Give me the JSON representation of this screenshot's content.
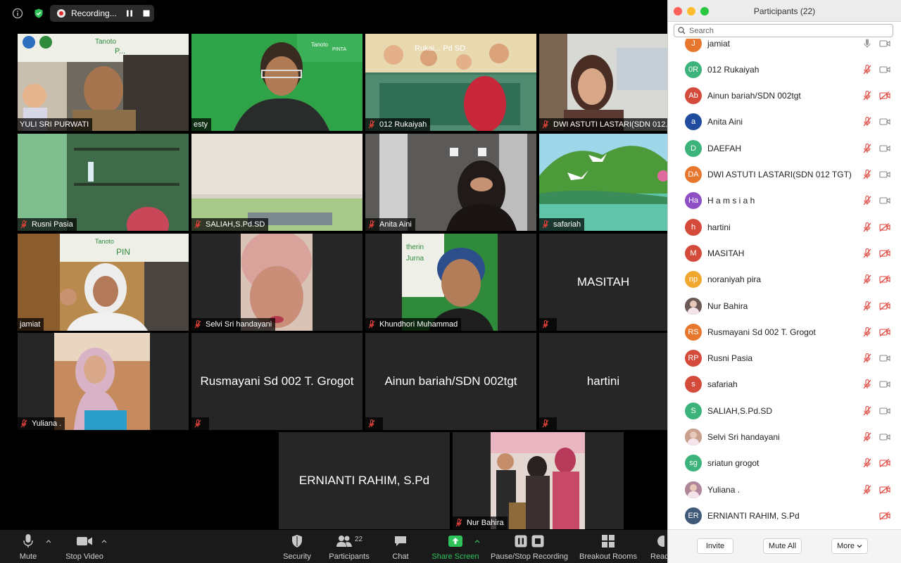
{
  "recording": {
    "label": "Recording..."
  },
  "tiles": [
    {
      "name": "YULI SRI PURWATI",
      "muted": false,
      "active": true,
      "scene": "classroom-poster"
    },
    {
      "name": "esty",
      "muted": false,
      "scene": "green-wall"
    },
    {
      "name": "012 Rukaiyah",
      "muted": true,
      "scene": "kids-banner"
    },
    {
      "name": "DWI ASTUTI LASTARI(SDN 012...",
      "muted": true,
      "scene": "office"
    },
    {
      "name": "Rusni Pasia",
      "muted": true,
      "scene": "shelf"
    },
    {
      "name": "SALIAH,S.Pd.SD",
      "muted": true,
      "scene": "ceiling"
    },
    {
      "name": "Anita Aini",
      "muted": true,
      "scene": "dark-room"
    },
    {
      "name": "safariah",
      "muted": true,
      "scene": "landscape"
    },
    {
      "name": "jamiat",
      "muted": false,
      "scene": "room-poster"
    },
    {
      "name": "Selvi Sri handayani",
      "muted": true,
      "scene": "closeup"
    },
    {
      "name": "Khundhori Muhammad",
      "muted": true,
      "scene": "portrait-green"
    },
    {
      "name": "",
      "muted": true,
      "bigname": "MASITAH"
    },
    {
      "name": "Yuliana .",
      "muted": true,
      "scene": "portrait-hijab"
    },
    {
      "name": "",
      "muted": true,
      "bigname": "Rusmayani Sd 002 T. Grogot"
    },
    {
      "name": "",
      "muted": true,
      "bigname": "Ainun bariah/SDN 002tgt"
    },
    {
      "name": "",
      "muted": true,
      "bigname": "hartini"
    },
    {
      "name": "",
      "muted": false,
      "bigname": "ERNIANTI RAHIM, S.Pd"
    },
    {
      "name": "Nur Bahira",
      "muted": true,
      "scene": "family"
    }
  ],
  "toolbar": {
    "mute": "Mute",
    "stop_video": "Stop Video",
    "security": "Security",
    "participants": "Participants",
    "participants_count": "22",
    "chat": "Chat",
    "share_screen": "Share Screen",
    "pause_recording": "Pause/Stop Recording",
    "breakout": "Breakout Rooms",
    "reactions": "Reac"
  },
  "panel": {
    "title": "Participants (22)",
    "search_placeholder": "Search",
    "invite": "Invite",
    "mute_all": "Mute All",
    "more": "More"
  },
  "participants": [
    {
      "name": "jamiat",
      "initials": "J",
      "color": "#e8772e",
      "mic": "on",
      "cam": "on"
    },
    {
      "name": "012 Rukaiyah",
      "initials": "0R",
      "color": "#3cb37a",
      "mic": "muted",
      "cam": "on"
    },
    {
      "name": "Ainun bariah/SDN 002tgt",
      "initials": "Ab",
      "color": "#d44b3b",
      "mic": "muted",
      "cam": "off"
    },
    {
      "name": "Anita Aini",
      "initials": "a",
      "color": "#1f4c9e",
      "mic": "muted",
      "cam": "on"
    },
    {
      "name": "DAEFAH",
      "initials": "D",
      "color": "#3cb37a",
      "mic": "muted",
      "cam": "on"
    },
    {
      "name": "DWI ASTUTI LASTARI(SDN 012 TGT)",
      "initials": "DA",
      "color": "#e8772e",
      "mic": "muted",
      "cam": "on"
    },
    {
      "name": "H a m s i a h",
      "initials": "Ha",
      "color": "#8e4fc4",
      "mic": "muted",
      "cam": "on"
    },
    {
      "name": "hartini",
      "initials": "h",
      "color": "#d44b3b",
      "mic": "muted",
      "cam": "off"
    },
    {
      "name": "MASITAH",
      "initials": "M",
      "color": "#d44b3b",
      "mic": "muted",
      "cam": "off"
    },
    {
      "name": "noraniyah pira",
      "initials": "np",
      "color": "#f0a830",
      "mic": "muted",
      "cam": "off"
    },
    {
      "name": "Nur Bahira",
      "initials": "",
      "color": "#6b5a55",
      "photo": true,
      "mic": "muted",
      "cam": "off"
    },
    {
      "name": "Rusmayani Sd 002 T. Grogot",
      "initials": "RS",
      "color": "#e8772e",
      "mic": "muted",
      "cam": "off"
    },
    {
      "name": "Rusni Pasia",
      "initials": "RP",
      "color": "#d44b3b",
      "mic": "muted",
      "cam": "on"
    },
    {
      "name": "safariah",
      "initials": "s",
      "color": "#d44b3b",
      "mic": "muted",
      "cam": "on"
    },
    {
      "name": "SALIAH,S.Pd.SD",
      "initials": "S",
      "color": "#3cb37a",
      "mic": "muted",
      "cam": "on"
    },
    {
      "name": "Selvi Sri handayani",
      "initials": "",
      "color": "#c9a08e",
      "photo": true,
      "mic": "muted",
      "cam": "on"
    },
    {
      "name": "sriatun grogot",
      "initials": "sg",
      "color": "#3cb37a",
      "mic": "muted",
      "cam": "off"
    },
    {
      "name": "Yuliana .",
      "initials": "",
      "color": "#b0879a",
      "photo": true,
      "mic": "muted",
      "cam": "off"
    },
    {
      "name": "ERNIANTI RAHIM, S.Pd",
      "initials": "ER",
      "color": "#3f5a78",
      "mic": "none",
      "cam": "off"
    }
  ],
  "colors": {
    "accent_green": "#2fc25b",
    "muted_red": "#e0413a",
    "active_border": "#d8e66a"
  }
}
